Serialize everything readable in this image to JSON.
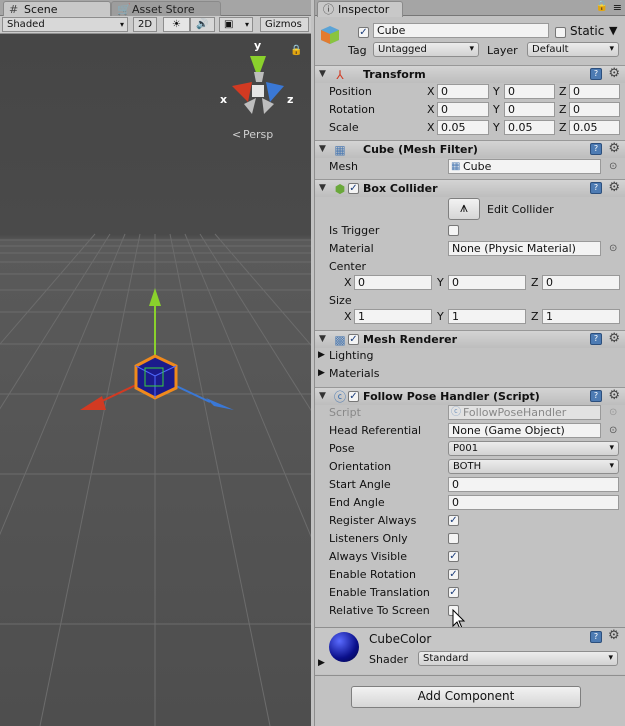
{
  "scene": {
    "tab_scene": "Scene",
    "tab_asset_store": "Asset Store",
    "draw_mode": "Shaded",
    "btn_2d": "2D",
    "gizmos": "Gizmos",
    "persp": "Persp",
    "axis_y": "y",
    "axis_x": "x",
    "axis_z": "z"
  },
  "inspector": {
    "tab": "Inspector",
    "object_name": "Cube",
    "static_label": "Static",
    "tag_label": "Tag",
    "tag_value": "Untagged",
    "layer_label": "Layer",
    "layer_value": "Default"
  },
  "transform": {
    "title": "Transform",
    "rows": [
      {
        "label": "Position",
        "x": "0",
        "y": "0",
        "z": "0"
      },
      {
        "label": "Rotation",
        "x": "0",
        "y": "0",
        "z": "0"
      },
      {
        "label": "Scale",
        "x": "0.05",
        "y": "0.05",
        "z": "0.05"
      }
    ],
    "ax_x": "X",
    "ax_y": "Y",
    "ax_z": "Z"
  },
  "mesh_filter": {
    "title": "Cube (Mesh Filter)",
    "mesh_label": "Mesh",
    "mesh_value": "Cube"
  },
  "box_collider": {
    "title": "Box Collider",
    "edit_label": "Edit Collider",
    "is_trigger": "Is Trigger",
    "material_label": "Material",
    "material_value": "None (Physic Material)",
    "center_label": "Center",
    "center": {
      "x": "0",
      "y": "0",
      "z": "0"
    },
    "size_label": "Size",
    "size": {
      "x": "1",
      "y": "1",
      "z": "1"
    }
  },
  "mesh_renderer": {
    "title": "Mesh Renderer",
    "lighting": "Lighting",
    "materials": "Materials"
  },
  "follow_pose": {
    "title": "Follow Pose Handler (Script)",
    "script_label": "Script",
    "script_value": "FollowPoseHandler",
    "head_label": "Head Referential",
    "head_value": "None (Game Object)",
    "pose_label": "Pose",
    "pose_value": "P001",
    "orientation_label": "Orientation",
    "orientation_value": "BOTH",
    "start_angle_label": "Start Angle",
    "start_angle_value": "0",
    "end_angle_label": "End Angle",
    "end_angle_value": "0",
    "toggles": [
      {
        "label": "Register Always",
        "checked": true
      },
      {
        "label": "Listeners Only",
        "checked": false
      },
      {
        "label": "Always Visible",
        "checked": true
      },
      {
        "label": "Enable Rotation",
        "checked": true
      },
      {
        "label": "Enable Translation",
        "checked": true
      },
      {
        "label": "Relative To Screen",
        "checked": false
      }
    ]
  },
  "material": {
    "name": "CubeColor",
    "shader_label": "Shader",
    "shader_value": "Standard"
  },
  "add_component": "Add Component",
  "colors": {
    "scene_bg": "#484848",
    "inspector_bg": "#c2c2c2",
    "axis_x": "#d23a22",
    "axis_y": "#8ad12c",
    "axis_z": "#3a78d6",
    "selection": "#f08a1c"
  }
}
